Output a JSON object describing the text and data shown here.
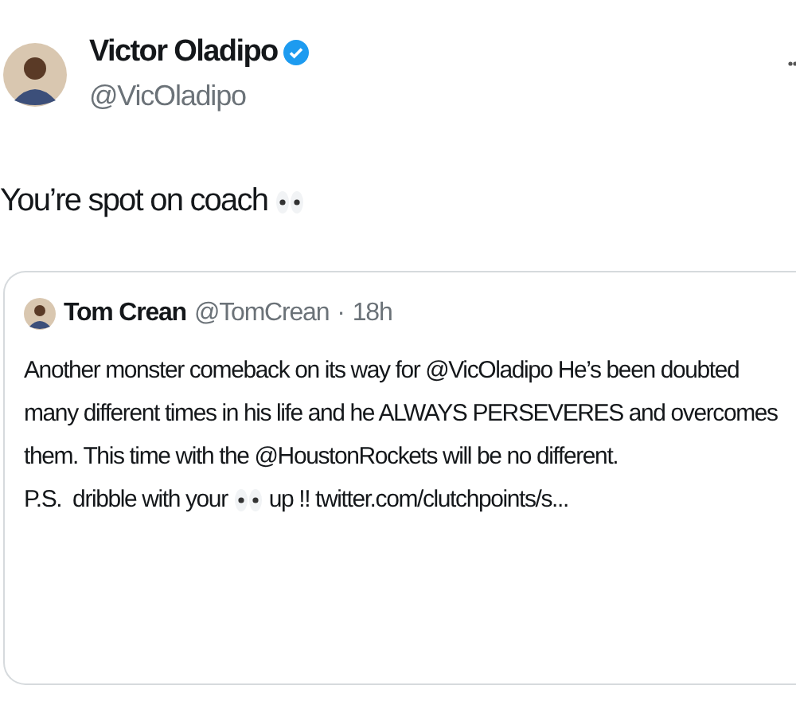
{
  "tweet": {
    "name": "Victor Oladipo",
    "verified": true,
    "handle": "@VicOladipo",
    "text": "You’re spot on coach",
    "quote": {
      "name": "Tom Crean",
      "handle": "@TomCrean",
      "separator": "·",
      "time": "18h",
      "body": "Another monster comeback on its way for @VicOladipo He’s been doubted many different times in his life and he ALWAYS PERSEVERES and overcomes them. This time with the @HoustonRockets will be no different.",
      "ps_before": "P.S.  dribble with your",
      "ps_after": "up !! twitter.com/clutchpoints/s..."
    }
  }
}
